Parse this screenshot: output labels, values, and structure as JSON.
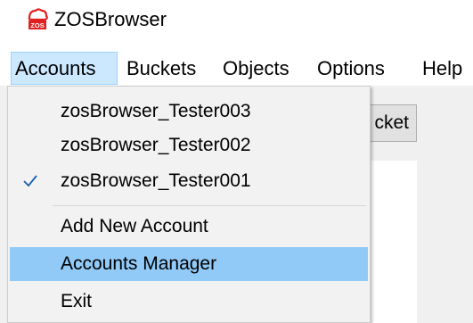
{
  "window": {
    "title": "ZOSBrowser",
    "icon": "zos-logo-icon",
    "icon_text": "ZOS"
  },
  "menubar": {
    "items": [
      {
        "label": "Accounts",
        "active": true
      },
      {
        "label": "Buckets"
      },
      {
        "label": "Objects"
      },
      {
        "label": "Options"
      },
      {
        "label": "Help"
      }
    ]
  },
  "background": {
    "button_label": "cket"
  },
  "accounts_menu": {
    "accounts": [
      {
        "label": "zosBrowser_Tester003",
        "checked": false
      },
      {
        "label": "zosBrowser_Tester002",
        "checked": false
      },
      {
        "label": "zosBrowser_Tester001",
        "checked": true
      }
    ],
    "actions": [
      {
        "label": "Add New Account"
      },
      {
        "label": "Accounts Manager",
        "highlighted": true
      },
      {
        "label": "Exit"
      }
    ]
  },
  "colors": {
    "brand_red": "#e02020",
    "menu_active_bg": "#cce8ff",
    "menu_highlight_bg": "#91c9f7",
    "check_color": "#1a5fb4"
  }
}
